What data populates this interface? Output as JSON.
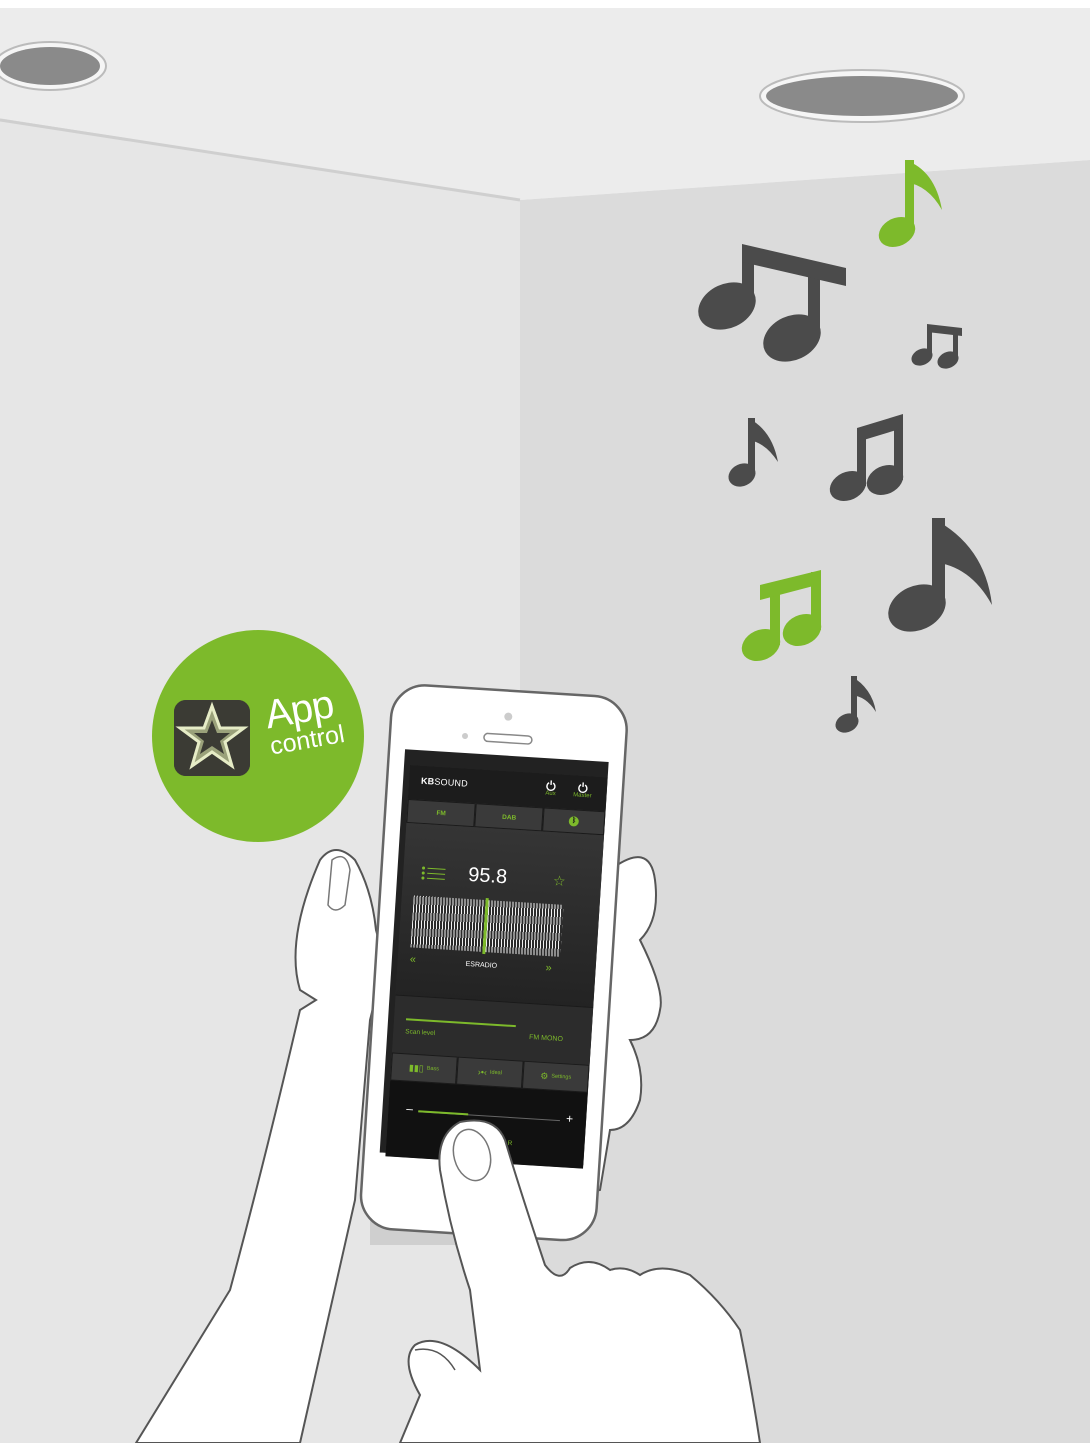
{
  "badge": {
    "title": "App",
    "subtitle": "control",
    "icon": "star-app-icon"
  },
  "app": {
    "brand_bold": "KB",
    "brand_rest": "SOUND",
    "power_buttons": [
      {
        "label": "Aux"
      },
      {
        "label": "Master"
      }
    ],
    "source_tabs": {
      "fm": "FM",
      "dab": "DAB",
      "bluetooth_icon": "bluetooth-icon"
    },
    "tuner": {
      "frequency": "95.8",
      "station": "ESRADIO",
      "prev": "«",
      "next": "»",
      "favorite": "☆"
    },
    "scan": {
      "label": "Scan level",
      "mode": "FM MONO"
    },
    "sound_buttons": {
      "bass": "Bass",
      "ideal": "Ideal",
      "settings": "Settings"
    },
    "volume": {
      "minus": "–",
      "plus": "+",
      "preset_start": "12",
      "preset_end": "TAR"
    }
  },
  "colors": {
    "accent": "#7dba2b",
    "dark_note": "#4b4b4b",
    "wall_left": "#e6e6e6",
    "wall_right": "#dbdbdb",
    "ceiling": "#ececec"
  }
}
